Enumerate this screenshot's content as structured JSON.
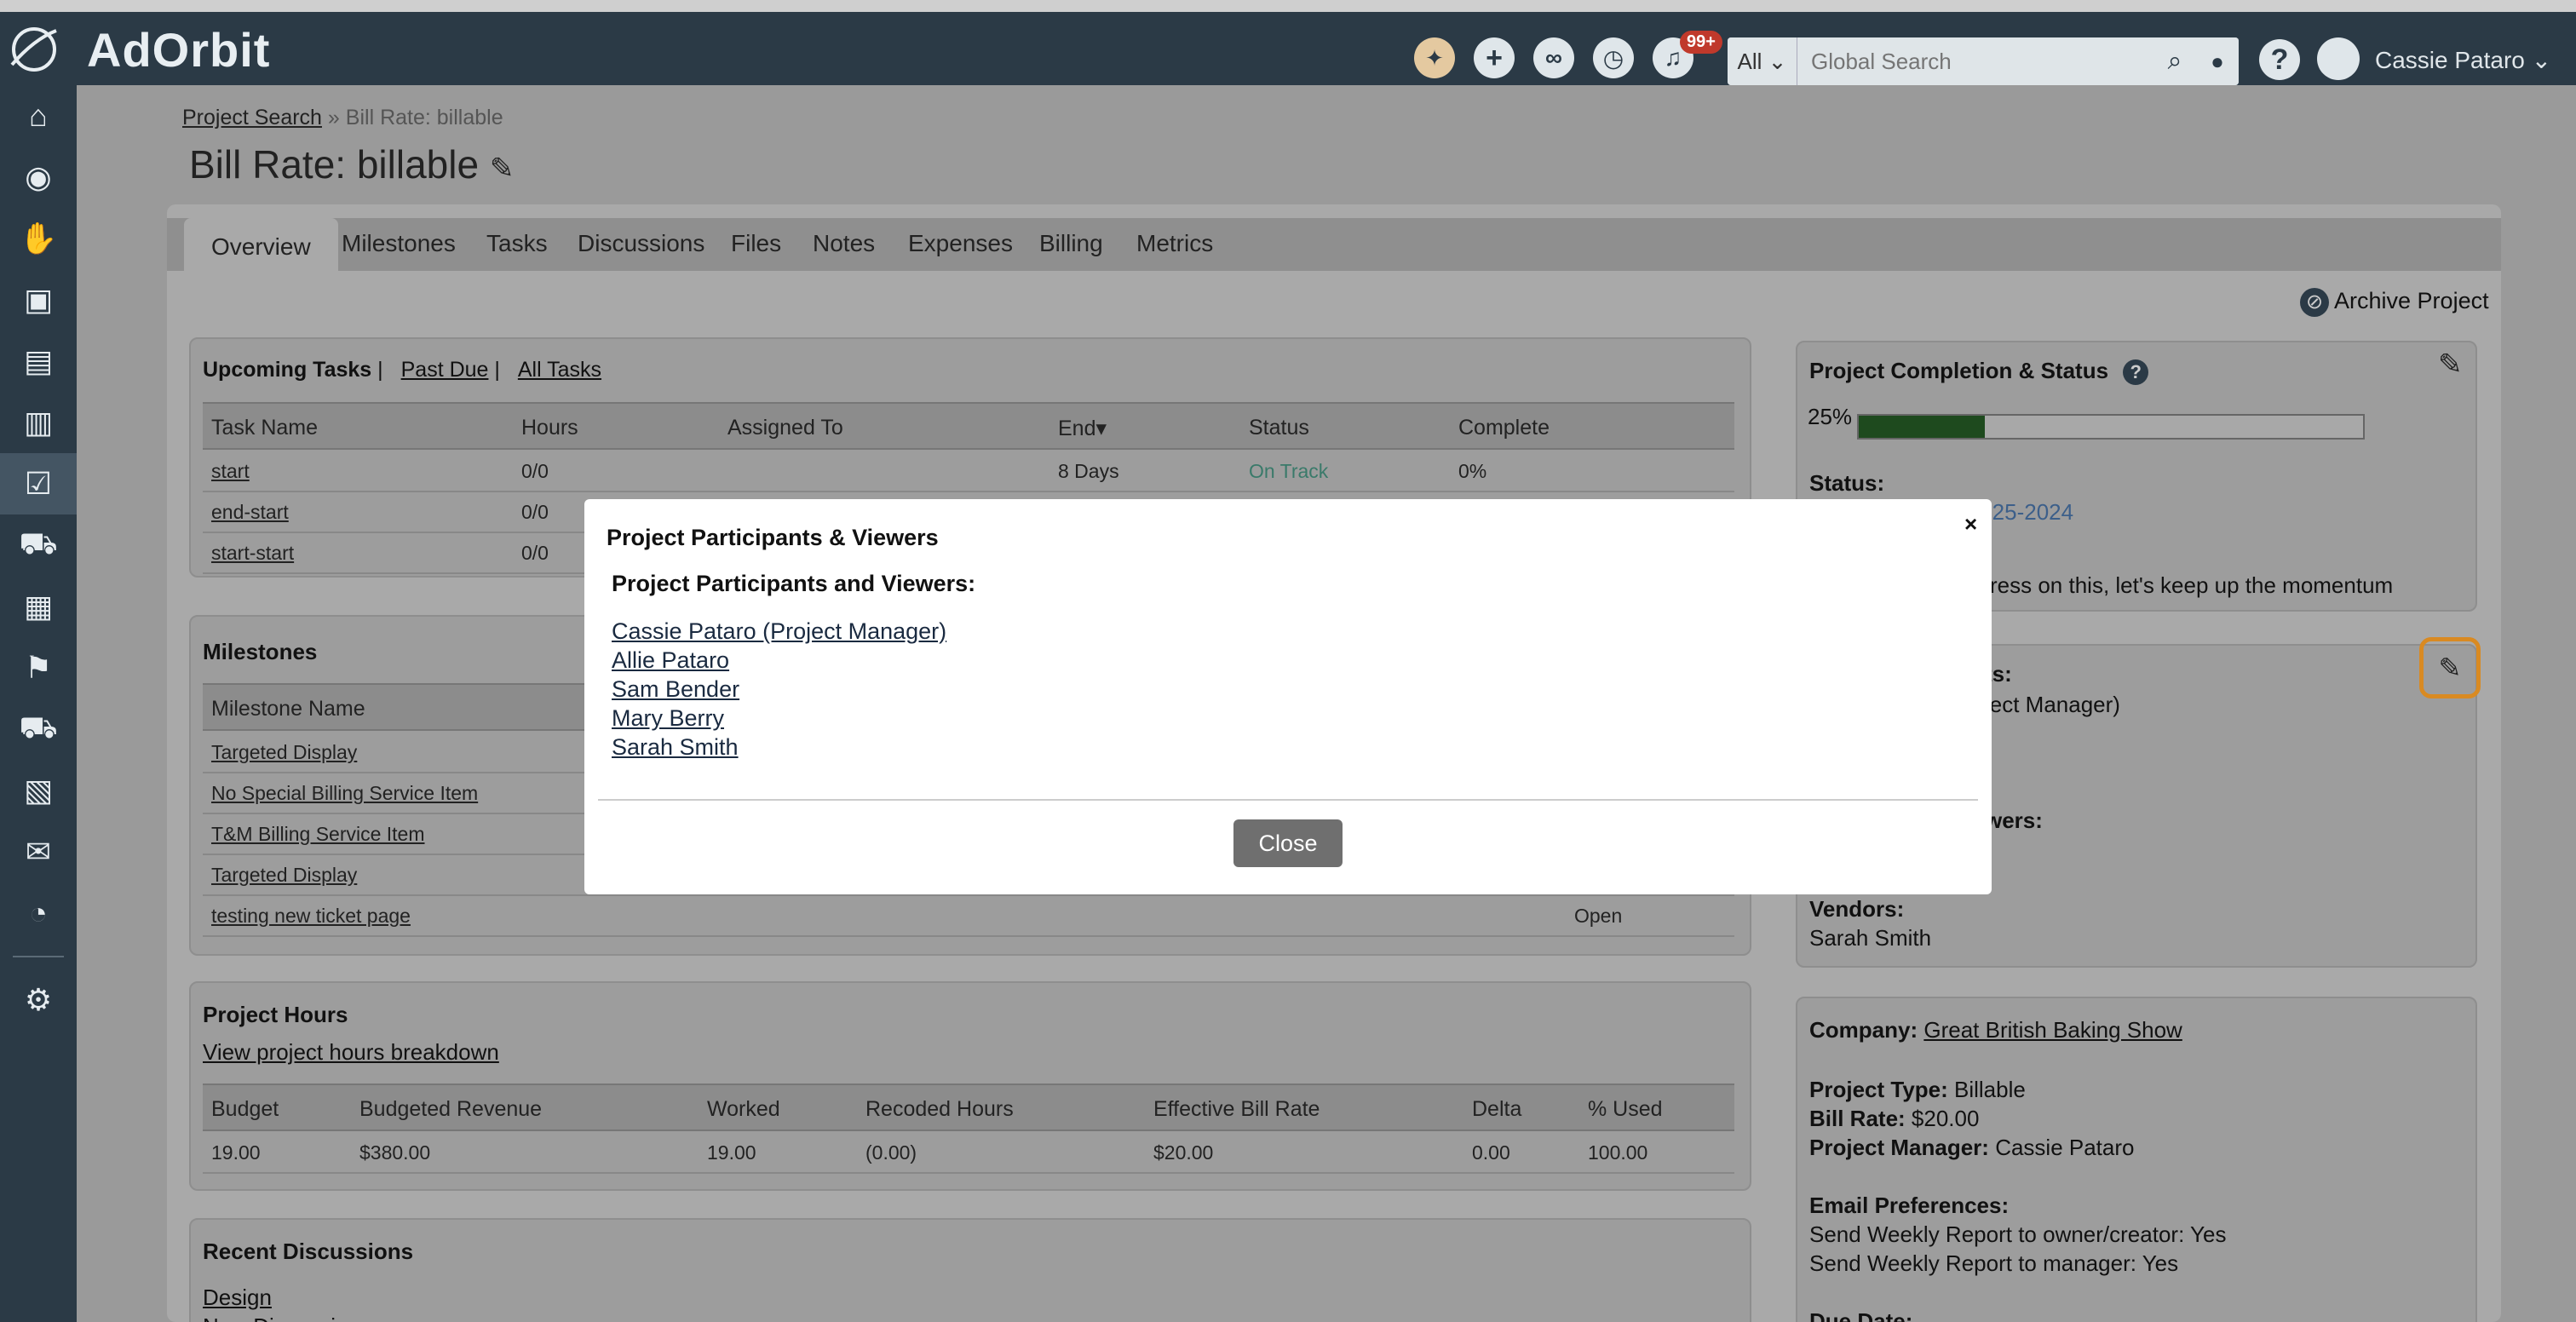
{
  "topbar": {
    "brand": "AdOrbit",
    "notifications_badge": "99+",
    "search_scope": "All",
    "search_placeholder": "Global Search",
    "user_name": "Cassie Pataro"
  },
  "breadcrumb": {
    "parent": "Project Search",
    "separator": "»",
    "current": "Bill Rate: billable"
  },
  "page_title": "Bill Rate: billable",
  "tabs": [
    "Overview",
    "Milestones",
    "Tasks",
    "Discussions",
    "Files",
    "Notes",
    "Expenses",
    "Billing",
    "Metrics"
  ],
  "archive_label": "Archive Project",
  "upcoming": {
    "label_upcoming": "Upcoming Tasks",
    "sep": "|",
    "label_past_due": "Past Due",
    "label_all": "All Tasks",
    "headers": [
      "Task Name",
      "Hours",
      "Assigned To",
      "End▾",
      "Status",
      "Complete"
    ],
    "rows": [
      {
        "name": "start",
        "hours": "0/0",
        "end": "8 Days",
        "status": "On Track",
        "complete": "0%"
      },
      {
        "name": "end-start",
        "hours": "0/0"
      },
      {
        "name": "start-start",
        "hours": "0/0"
      }
    ]
  },
  "milestones": {
    "title": "Milestones",
    "header": "Milestone Name",
    "rows": [
      "Targeted Display",
      "No Special Billing Service Item",
      "T&M Billing Service Item",
      "Targeted Display",
      "testing new ticket page"
    ],
    "last_status": "Open"
  },
  "hours": {
    "title": "Project Hours",
    "breakdown_link": "View project hours breakdown",
    "headers": [
      "Budget",
      "Budgeted Revenue",
      "Worked",
      "Recoded Hours",
      "Effective Bill Rate",
      "Delta",
      "% Used"
    ],
    "values": [
      "19.00",
      "$380.00",
      "19.00",
      "(0.00)",
      "$20.00",
      "0.00",
      "100.00"
    ]
  },
  "discussions": {
    "title": "Recent Discussions",
    "first": "Design",
    "second": "New Discussion"
  },
  "completion": {
    "title": "Project Completion & Status",
    "percent_label": "25%",
    "percent": 25,
    "status_label": "Status:",
    "status_date": "-25-2024",
    "status_note": "ress on this, let's keep up the momentum"
  },
  "participants_card": {
    "label1": "ts:",
    "pm_line": "ject Manager)",
    "label2": "wers:",
    "vendors_label": "Vendors:",
    "vendor": "Sarah Smith"
  },
  "details": {
    "company_label": "Company:",
    "company": "Great British Baking Show",
    "type_label": "Project Type:",
    "type": "Billable",
    "rate_label": "Bill Rate:",
    "rate": "$20.00",
    "pm_label": "Project Manager:",
    "pm": "Cassie Pataro",
    "email_label": "Email Preferences:",
    "email1": "Send Weekly Report to owner/creator: Yes",
    "email2": "Send Weekly Report to manager: Yes",
    "due_label": "Due Date:"
  },
  "modal": {
    "title": "Project Participants & Viewers",
    "close_x": "×",
    "subtitle": "Project Participants and Viewers:",
    "people": [
      "Cassie Pataro (Project Manager)",
      "Allie Pataro",
      "Sam Bender",
      "Mary Berry",
      "Sarah Smith"
    ],
    "close_label": "Close"
  },
  "colors": {
    "nav": "#2b3a46",
    "accent": "#d98a22",
    "progress": "#1e4a1e",
    "on_track": "#3a7a6a",
    "date_link": "#3c5f8a"
  }
}
